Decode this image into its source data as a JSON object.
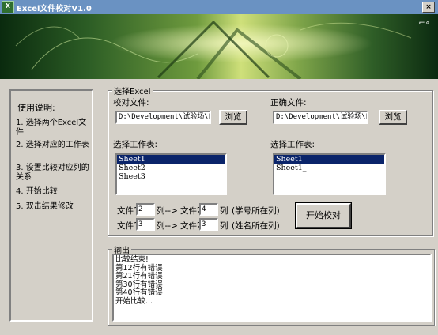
{
  "window": {
    "title": "Excel文件校对V1.0",
    "close_glyph": "×"
  },
  "instructions": {
    "title": "使用说明:",
    "items": [
      "1. 选择两个Excel文件",
      "2. 选择对应的工作表",
      "3. 设置比较对应列的关系",
      "4. 开始比较",
      "5. 双击结果修改"
    ]
  },
  "select_group": {
    "label": "选择Excel"
  },
  "left": {
    "file_label": "校对文件:",
    "path": "D:\\Development\\试验场\\E:",
    "browse": "浏览",
    "sheet_label": "选择工作表:",
    "sheets": [
      "Sheet1",
      "Sheet2",
      "Sheet3"
    ]
  },
  "right": {
    "file_label": "正确文件:",
    "path": "D:\\Development\\试验场\\E:",
    "browse": "浏览",
    "sheet_label": "选择工作表:",
    "sheets": [
      "Sheet1",
      "Sheet1_"
    ]
  },
  "mapping": {
    "row1": {
      "file1": "文件1",
      "col1": "2",
      "arrow": "列-->",
      "file2": "文件2",
      "col2": "4",
      "unit": "列",
      "note": "(学号所在列)"
    },
    "row2": {
      "file1": "文件1",
      "col1": "3",
      "arrow": "列-->",
      "file2": "文件2",
      "col2": "3",
      "unit": "列",
      "note": "(姓名所在列)"
    }
  },
  "start_button": "开始校对",
  "output": {
    "label": "输出",
    "lines": [
      "比较结束!",
      "第12行有错误!",
      "第21行有错误!",
      "第30行有错误!",
      "第40行有错误!",
      "开始比较..."
    ]
  }
}
